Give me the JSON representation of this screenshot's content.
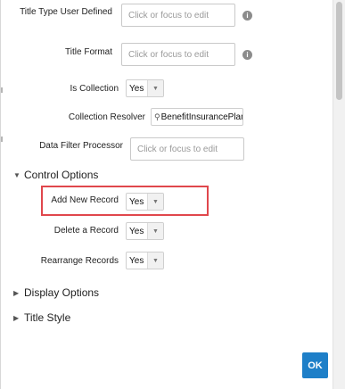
{
  "fields": {
    "title_type": {
      "label": "Title Type User Defined",
      "placeholder": "Click or focus to edit"
    },
    "title_format": {
      "label": "Title Format",
      "placeholder": "Click or focus to edit"
    },
    "is_collection": {
      "label": "Is Collection",
      "value": "Yes"
    },
    "collection_resolver": {
      "label": "Collection Resolver",
      "value": "BenefitInsurancePlan"
    },
    "data_filter": {
      "label": "Data Filter Processor",
      "placeholder": "Click or focus to edit"
    }
  },
  "sections": {
    "control_options": "Control Options",
    "display_options": "Display Options",
    "title_style": "Title Style"
  },
  "control_options": {
    "add_new_record": {
      "label": "Add New Record",
      "value": "Yes"
    },
    "delete_record": {
      "label": "Delete a Record",
      "value": "Yes"
    },
    "rearrange_records": {
      "label": "Rearrange Records",
      "value": "Yes"
    }
  },
  "icons": {
    "info": "info-icon",
    "expanded": "triangle-down-icon",
    "collapsed": "triangle-right-icon",
    "dropdown": "chevron-down-icon",
    "search": "magnifier-icon"
  },
  "colors": {
    "highlight_border": "#e0474c",
    "ok_button": "#1e7fc8"
  },
  "ok_button": "OK"
}
